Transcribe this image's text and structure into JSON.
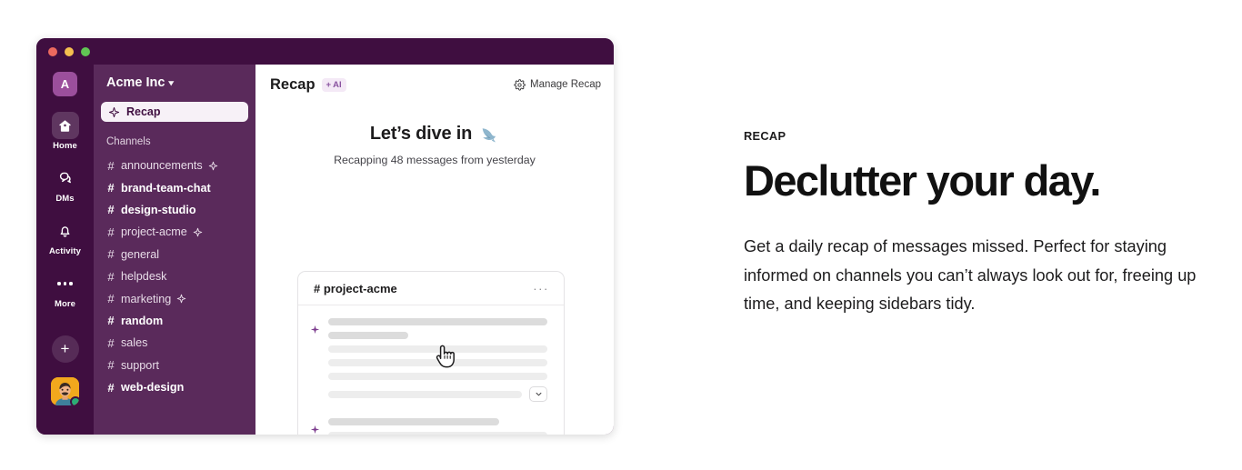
{
  "window": {
    "traffic_lights": [
      {
        "name": "close",
        "color": "#EC6A5F"
      },
      {
        "name": "minimize",
        "color": "#F4BF4F"
      },
      {
        "name": "maximize",
        "color": "#61C554"
      }
    ]
  },
  "rail": {
    "workspace_initial": "A",
    "items": [
      {
        "label": "Home",
        "icon": "home-icon",
        "active": true
      },
      {
        "label": "DMs",
        "icon": "dms-icon",
        "active": false
      },
      {
        "label": "Activity",
        "icon": "bell-icon",
        "active": false
      },
      {
        "label": "More",
        "icon": "ellipsis-icon",
        "active": false
      }
    ],
    "new_button": "+",
    "avatar_alt": "user-avatar",
    "presence": "online"
  },
  "sidebar": {
    "workspace_name": "Acme Inc",
    "recap_item": "Recap",
    "channels_heading": "Channels",
    "channels": [
      {
        "name": "announcements",
        "unread": false,
        "ai": true
      },
      {
        "name": "brand-team-chat",
        "unread": true,
        "ai": false
      },
      {
        "name": "design-studio",
        "unread": true,
        "ai": false
      },
      {
        "name": "project-acme",
        "unread": false,
        "ai": true
      },
      {
        "name": "general",
        "unread": false,
        "ai": false
      },
      {
        "name": "helpdesk",
        "unread": false,
        "ai": false
      },
      {
        "name": "marketing",
        "unread": false,
        "ai": true
      },
      {
        "name": "random",
        "unread": true,
        "ai": false
      },
      {
        "name": "sales",
        "unread": false,
        "ai": false
      },
      {
        "name": "support",
        "unread": false,
        "ai": false
      },
      {
        "name": "web-design",
        "unread": true,
        "ai": false
      }
    ]
  },
  "main": {
    "title": "Recap",
    "ai_badge": "AI",
    "manage_label": "Manage Recap",
    "hero_title": "Let’s dive in",
    "hero_emoji": "dolphin",
    "hero_subtitle": "Recapping 48 messages from yesterday",
    "card": {
      "channel": "# project-acme",
      "more_label": "···",
      "expand_label": "expand"
    }
  },
  "promo": {
    "eyebrow": "RECAP",
    "heading": "Declutter your day.",
    "body": "Get a daily recap of messages missed. Perfect for staying informed on channels you can’t always look out for, freeing up time, and keeping sidebars tidy."
  },
  "colors": {
    "window_chrome": "#3F0E40",
    "sidebar": "#5A2A5B",
    "accent_purple": "#8A53A0",
    "ai_badge_bg": "#F4E9F6",
    "presence_green": "#2BAC76"
  }
}
